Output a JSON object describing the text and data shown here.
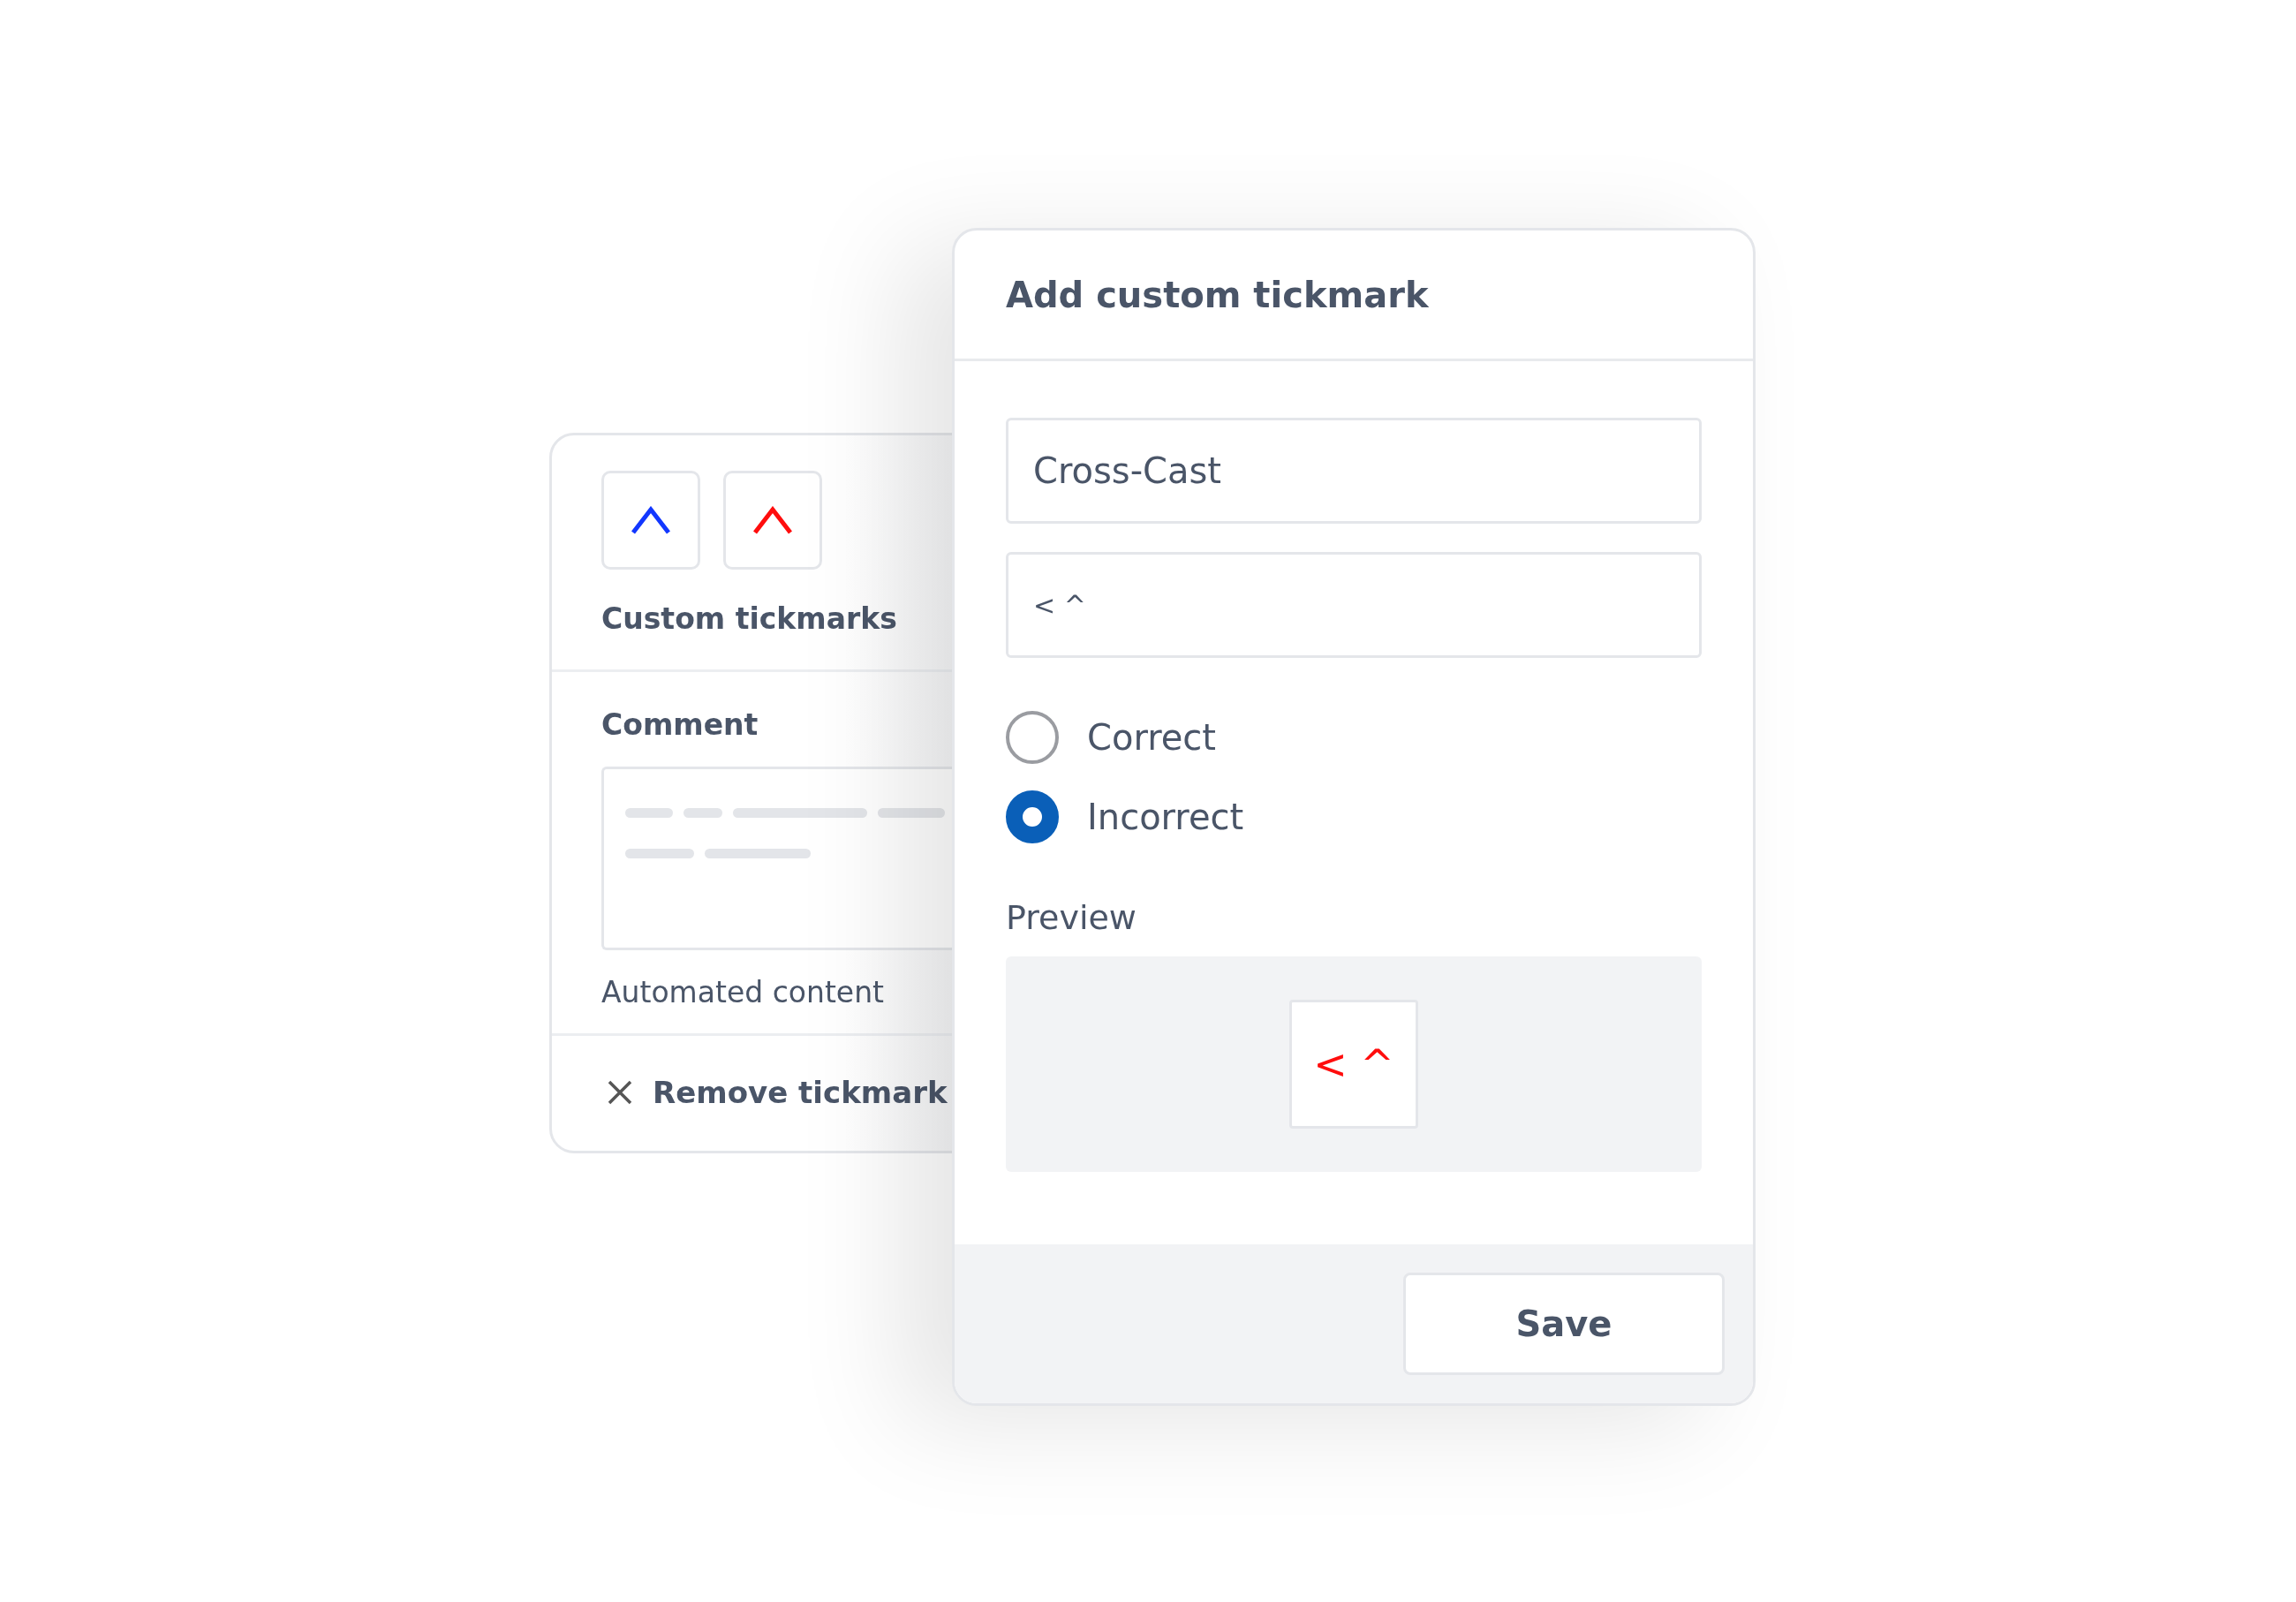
{
  "back_panel": {
    "tickmarks": [
      {
        "color": "#1237ff"
      },
      {
        "color": "#ff0d0d"
      }
    ],
    "tickmarks_label": "Custom tickmarks",
    "comment_label": "Comment",
    "automated_content": "Automated content",
    "remove_action": "Remove tickmark"
  },
  "dialog": {
    "title": "Add custom tickmark",
    "name_field": {
      "value": "Cross-Cast"
    },
    "symbol_field": {
      "value": "< ^"
    },
    "options": [
      {
        "label": "Correct",
        "selected": false
      },
      {
        "label": "Incorrect",
        "selected": true
      }
    ],
    "preview_label": "Preview",
    "preview_symbol": "< ^",
    "buttons": [
      "Save"
    ]
  }
}
